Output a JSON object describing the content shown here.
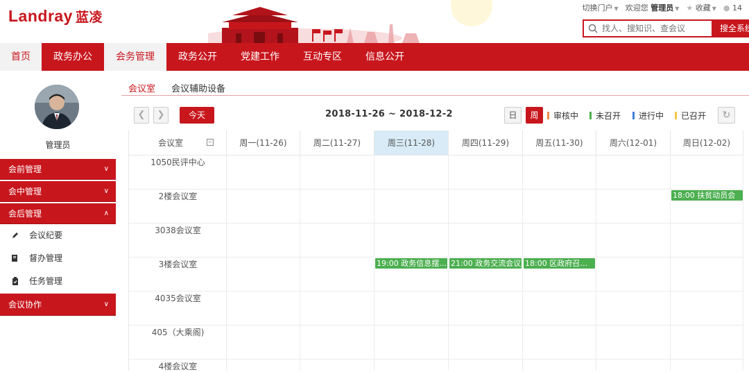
{
  "header": {
    "logo_text": "Landray",
    "logo_cn": "蓝凌",
    "portal_switch": "切换门户",
    "welcome": "欢迎您",
    "user": "管理员",
    "favorites": "收藏",
    "notification_count": "14",
    "search_placeholder": "找人、搜知识、查会议",
    "search_button": "搜全系统"
  },
  "nav": {
    "items": [
      "首页",
      "政务办公",
      "会务管理",
      "政务公开",
      "党建工作",
      "互动专区",
      "信息公开"
    ],
    "active_index": 2
  },
  "sidebar": {
    "username": "管理员",
    "groups": [
      {
        "label": "会前管理",
        "expanded": false
      },
      {
        "label": "会中管理",
        "expanded": false
      },
      {
        "label": "会后管理",
        "expanded": true
      },
      {
        "label": "会议协作",
        "expanded": false
      }
    ],
    "subitems": [
      {
        "label": "会议纪要",
        "icon": "pen-icon"
      },
      {
        "label": "督办管理",
        "icon": "document-icon"
      },
      {
        "label": "任务管理",
        "icon": "clipboard-icon"
      }
    ]
  },
  "tabs": {
    "items": [
      "会议室",
      "会议辅助设备"
    ],
    "active_index": 0
  },
  "toolbar": {
    "prev_icon": "chevron-left-icon",
    "next_icon": "chevron-right-icon",
    "today_label": "今天",
    "date_range": "2018-11-26 ~ 2018-12-2",
    "view_day": "日",
    "view_week": "周",
    "legend": [
      {
        "label": "审核中",
        "color": "#f0884a"
      },
      {
        "label": "未召开",
        "color": "#4caf50"
      },
      {
        "label": "进行中",
        "color": "#3f7fd8"
      },
      {
        "label": "已召开",
        "color": "#f5c542"
      }
    ],
    "refresh_icon": "refresh-icon"
  },
  "calendar": {
    "room_header": "会议室",
    "days": [
      "周一(11-26)",
      "周二(11-27)",
      "周三(11-28)",
      "周四(11-29)",
      "周五(11-30)",
      "周六(12-01)",
      "周日(12-02)"
    ],
    "highlighted_day_index": 2,
    "rooms": [
      "1050民评中心",
      "2楼会议室",
      "3038会议室",
      "3楼会议室",
      "4035会议室",
      "405（大乘阁)",
      "4楼会议室"
    ],
    "events": [
      {
        "room_index": 1,
        "day_index": 6,
        "label": "18:00 扶贫动员会"
      },
      {
        "room_index": 3,
        "day_index": 2,
        "label": "19:00 政务信息摆…"
      },
      {
        "room_index": 3,
        "day_index": 3,
        "label": "21:00 政务交流会议"
      },
      {
        "room_index": 3,
        "day_index": 4,
        "label": "18:00 区政府召开…"
      }
    ],
    "event_color": "#4caf50"
  }
}
